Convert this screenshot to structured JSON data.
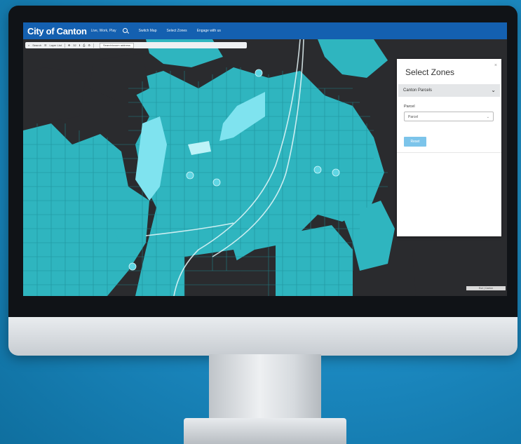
{
  "app": {
    "brand": "City of Canton",
    "tagline": "Live, Work, Play",
    "nav": [
      "Switch Map",
      "Select Zones",
      "Engage with us"
    ]
  },
  "toolbar": {
    "search": "Search",
    "layer_list": "Layer List",
    "zoom": "32",
    "address": "Search/zoom address"
  },
  "panel": {
    "title": "Select Zones",
    "close": "×",
    "layer_dropdown": "Canton Parcels",
    "field_label": "Parcel",
    "select_value": "Parcel",
    "button": "Reset"
  },
  "map": {
    "attribution": "Esri | Canton"
  },
  "colors": {
    "appbar": "#1460b0",
    "parcel": "#2fb5bf",
    "parcel_dark": "#1d8c96",
    "background": "#2a2b2e",
    "highlight": "#7fe3ef"
  }
}
